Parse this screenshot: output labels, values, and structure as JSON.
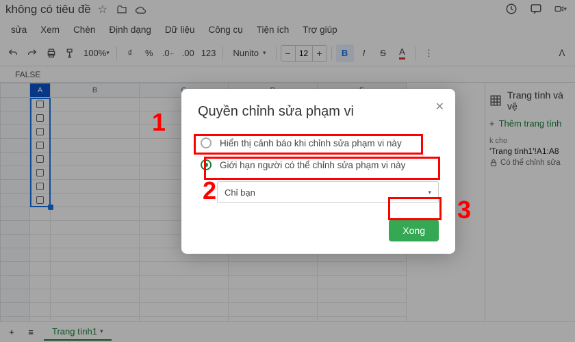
{
  "titlebar": {
    "title": "không có tiêu đề"
  },
  "menu": {
    "items": [
      "sửa",
      "Xem",
      "Chèn",
      "Định dạng",
      "Dữ liệu",
      "Công cụ",
      "Tiện ích",
      "Trợ giúp"
    ]
  },
  "toolbar": {
    "zoom": "100%",
    "font": "Nunito",
    "size": "12",
    "minus": "−",
    "plus": "+"
  },
  "fx": {
    "value": "FALSE"
  },
  "columns": [
    "A",
    "B",
    "C",
    "D",
    "E"
  ],
  "grid": {
    "checkbox_rows": 8
  },
  "side": {
    "title": "Trang tính và",
    "title2": "vệ",
    "add": "Thêm trang tính",
    "k_cho": "k cho",
    "range": "'Trang tính1'!A1:A8",
    "can_edit": "Có thể chỉnh sửa"
  },
  "sheetbar": {
    "tab": "Trang tính1"
  },
  "dialog": {
    "title": "Quyền chỉnh sửa phạm vi",
    "opt1": "Hiển thị cảnh báo khi chỉnh sửa phạm vi này",
    "opt2": "Giới hạn người có thể chỉnh sửa phạm vi này",
    "select": "Chỉ bạn",
    "done": "Xong"
  },
  "annotations": {
    "n1": "1",
    "n2": "2",
    "n3": "3"
  }
}
